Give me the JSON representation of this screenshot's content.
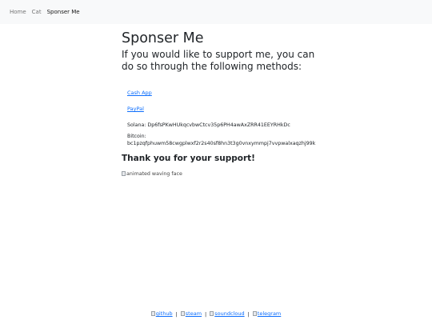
{
  "nav": {
    "items": [
      {
        "label": "Home"
      },
      {
        "label": "Cat"
      },
      {
        "label": "Sponser Me"
      }
    ]
  },
  "main": {
    "title": "Sponser Me",
    "intro": "If you would like to support me, you can do so through the following methods:",
    "links": {
      "cashapp": "Cash App",
      "paypal": "PayPal"
    },
    "solana": "Solana: Dp6fsPKwHUkqcvbwCtcv35p6PH4awAxZRR41EEYRHkDc",
    "bitcoin_label": "Bitcoin:",
    "bitcoin_address": "bc1pzqfphuwm58cwgplwxf2r2s40sf8hn3t3g0vnxymmpj7vvpwalxaqzhj99k",
    "thanks": "Thank you for your support!",
    "image_alt": "animated waving face"
  },
  "footer": {
    "links": [
      "github",
      "steam",
      "soundcloud",
      "telegram"
    ],
    "separator": "|"
  }
}
